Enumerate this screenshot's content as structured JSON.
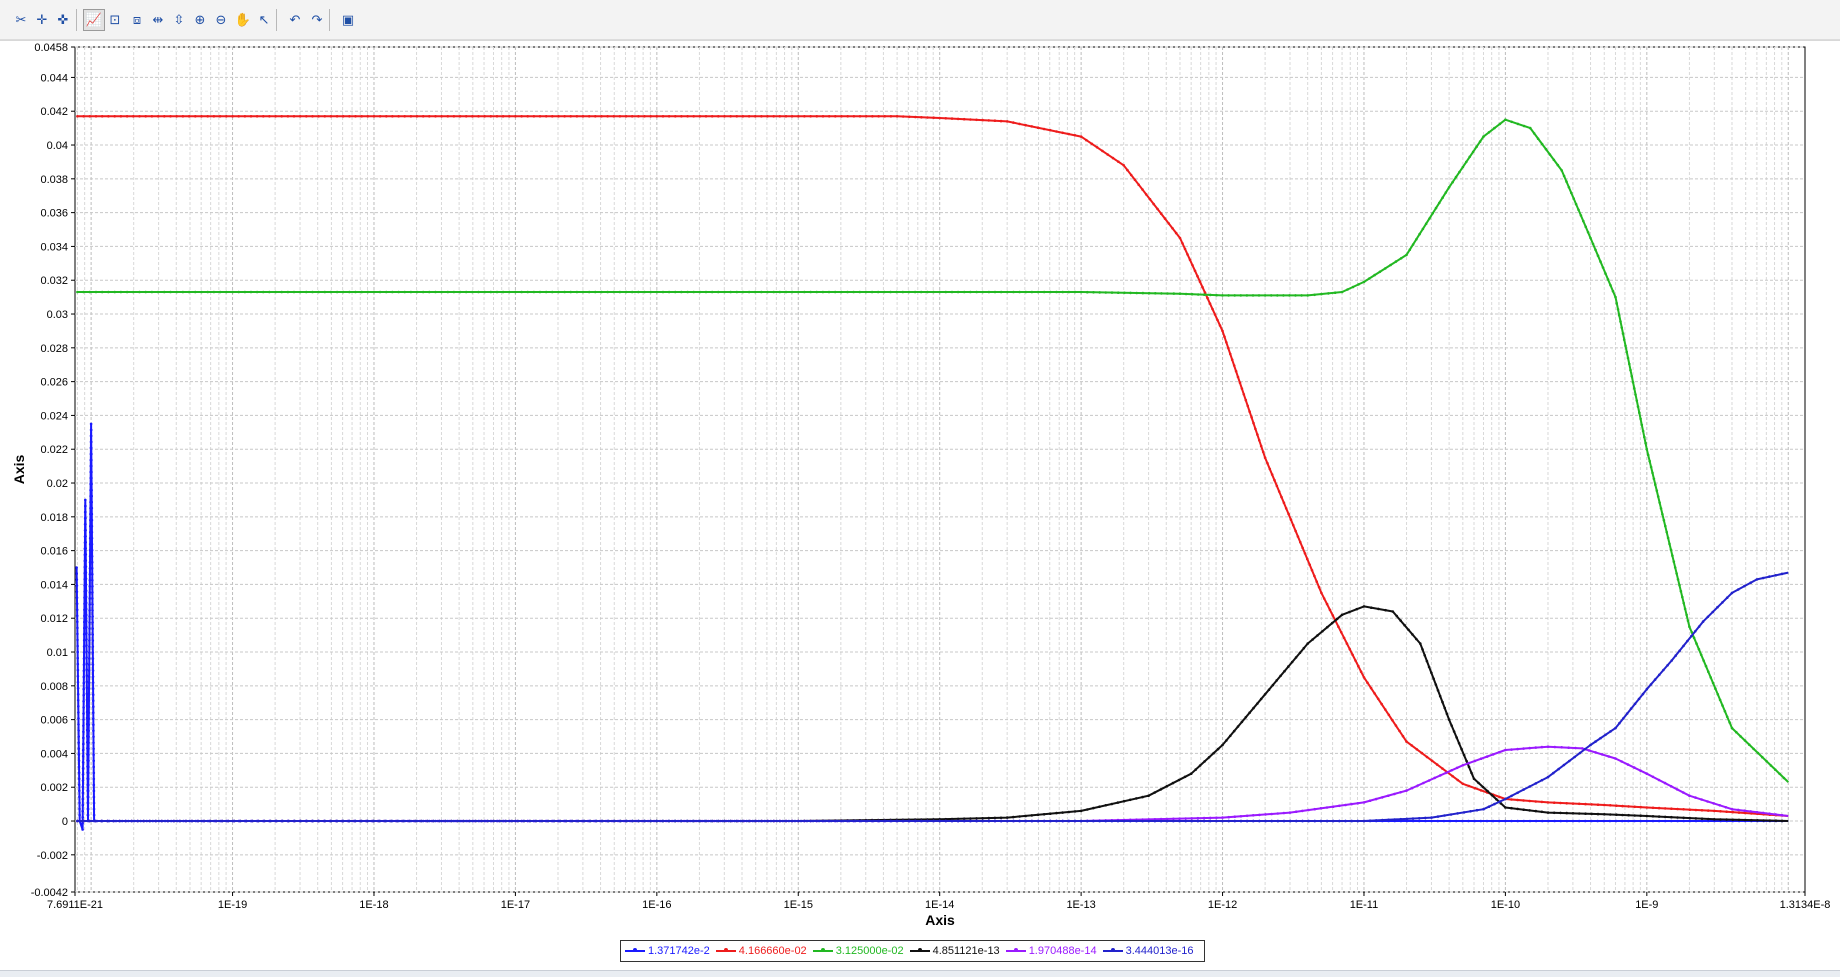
{
  "toolbar": {
    "buttons": [
      {
        "name": "tools-icon",
        "glyph": "✂"
      },
      {
        "name": "add-point-icon",
        "glyph": "✛"
      },
      {
        "name": "remove-point-icon",
        "glyph": "✜"
      },
      {
        "name": "chart-view-icon",
        "glyph": "📈"
      },
      {
        "name": "zoom-box-icon",
        "glyph": "⊡"
      },
      {
        "name": "zoom-fit-icon",
        "glyph": "⧈"
      },
      {
        "name": "zoom-horizontal-icon",
        "glyph": "⇹"
      },
      {
        "name": "zoom-vertical-icon",
        "glyph": "⇳"
      },
      {
        "name": "zoom-in-icon",
        "glyph": "⊕"
      },
      {
        "name": "zoom-out-icon",
        "glyph": "⊖"
      },
      {
        "name": "pan-hand-icon",
        "glyph": "✋"
      },
      {
        "name": "select-pointer-icon",
        "glyph": "↖"
      },
      {
        "name": "undo-icon",
        "glyph": "↶"
      },
      {
        "name": "redo-icon",
        "glyph": "↷"
      },
      {
        "name": "export-image-icon",
        "glyph": "▣"
      }
    ]
  },
  "chart_data": {
    "type": "line",
    "xlabel": "Axis",
    "ylabel": "Axis",
    "xscale": "log",
    "xlim": [
      7.6911e-21,
      1.3134e-08
    ],
    "ylim": [
      -0.0042,
      0.0458
    ],
    "grid": true,
    "legend_position": "bottom",
    "x_tick_labels": [
      "7.6911E-21",
      "1E-19",
      "1E-18",
      "1E-17",
      "1E-16",
      "1E-15",
      "1E-14",
      "1E-13",
      "1E-12",
      "1E-11",
      "1E-10",
      "1E-9",
      "1.3134E-8"
    ],
    "x_tick_values": [
      7.6911e-21,
      1e-19,
      1e-18,
      1e-17,
      1e-16,
      1e-15,
      1e-14,
      1e-13,
      1e-12,
      1e-11,
      1e-10,
      1e-09,
      1.3134e-08
    ],
    "y_tick_labels": [
      "0.0458",
      "0.044",
      "0.042",
      "0.04",
      "0.038",
      "0.036",
      "0.034",
      "0.032",
      "0.03",
      "0.028",
      "0.026",
      "0.024",
      "0.022",
      "0.02",
      "0.018",
      "0.016",
      "0.014",
      "0.012",
      "0.01",
      "0.008",
      "0.006",
      "0.004",
      "0.002",
      "0",
      "-0.002",
      "-0.0042"
    ],
    "y_tick_values": [
      0.0458,
      0.044,
      0.042,
      0.04,
      0.038,
      0.036,
      0.034,
      0.032,
      0.03,
      0.028,
      0.026,
      0.024,
      0.022,
      0.02,
      0.018,
      0.016,
      0.014,
      0.012,
      0.01,
      0.008,
      0.006,
      0.004,
      0.002,
      0,
      -0.002,
      -0.0042
    ],
    "series": [
      {
        "name": "1.371742e-2",
        "color": "#1a1aff",
        "x": [
          7.9e-21,
          8.3e-21,
          8.7e-21,
          9.1e-21,
          9.5e-21,
          1e-20,
          1.05e-20,
          1.1e-20,
          1.2e-20,
          1.5e-20,
          1e-19,
          1e-18,
          1e-17,
          1e-16,
          1e-15,
          1e-14,
          1e-13,
          1e-12,
          1e-11,
          1e-10,
          1e-09,
          1e-08
        ],
        "y": [
          0.015,
          0,
          -0.0005,
          0.019,
          0,
          0.0235,
          0,
          0,
          0,
          0,
          0,
          0,
          0,
          0,
          0,
          0,
          0,
          0,
          0,
          0,
          0,
          0
        ]
      },
      {
        "name": "4.166660e-02",
        "color": "#ee1c1c",
        "x": [
          8e-21,
          1e-19,
          1e-18,
          1e-17,
          1e-16,
          1e-15,
          5e-15,
          1e-14,
          3e-14,
          1e-13,
          2e-13,
          5e-13,
          1e-12,
          2e-12,
          5e-12,
          1e-11,
          2e-11,
          5e-11,
          1e-10,
          2e-10,
          5e-10,
          1e-09,
          3e-09,
          1e-08
        ],
        "y": [
          0.0417,
          0.0417,
          0.0417,
          0.0417,
          0.0417,
          0.0417,
          0.0417,
          0.0416,
          0.0414,
          0.0405,
          0.0388,
          0.0345,
          0.029,
          0.0215,
          0.0135,
          0.0085,
          0.0047,
          0.0022,
          0.0013,
          0.0011,
          0.00095,
          0.0008,
          0.0006,
          0.0003
        ]
      },
      {
        "name": "3.125000e-02",
        "color": "#22b822",
        "x": [
          8e-21,
          1e-19,
          1e-18,
          1e-17,
          1e-16,
          1e-15,
          1e-14,
          1e-13,
          5e-13,
          1e-12,
          2e-12,
          4e-12,
          7e-12,
          1e-11,
          2e-11,
          4e-11,
          7e-11,
          1e-10,
          1.5e-10,
          2.5e-10,
          4e-10,
          6e-10,
          1e-09,
          2e-09,
          4e-09,
          1e-08
        ],
        "y": [
          0.0313,
          0.0313,
          0.0313,
          0.0313,
          0.0313,
          0.0313,
          0.0313,
          0.0313,
          0.0312,
          0.0311,
          0.0311,
          0.0311,
          0.0313,
          0.0319,
          0.0335,
          0.0375,
          0.0405,
          0.0415,
          0.041,
          0.0385,
          0.0345,
          0.031,
          0.022,
          0.0115,
          0.0055,
          0.0023
        ]
      },
      {
        "name": "4.851121e-13",
        "color": "#111111",
        "x": [
          8e-21,
          1e-16,
          1e-15,
          1e-14,
          3e-14,
          1e-13,
          3e-13,
          6e-13,
          1e-12,
          2e-12,
          4e-12,
          7e-12,
          1e-11,
          1.6e-11,
          2.5e-11,
          4e-11,
          6e-11,
          1e-10,
          2e-10,
          5e-10,
          1e-09,
          3e-09,
          1e-08
        ],
        "y": [
          0,
          0,
          0,
          0.0001,
          0.0002,
          0.0006,
          0.0015,
          0.0028,
          0.0045,
          0.0075,
          0.0105,
          0.0122,
          0.0127,
          0.0124,
          0.0105,
          0.006,
          0.0025,
          0.0008,
          0.0005,
          0.0004,
          0.0003,
          0.0001,
          0
        ]
      },
      {
        "name": "1.970488e-14",
        "color": "#9a1aff",
        "x": [
          8e-21,
          1e-15,
          1e-14,
          1e-13,
          1e-12,
          3e-12,
          1e-11,
          2e-11,
          5e-11,
          1e-10,
          2e-10,
          3.5e-10,
          6e-10,
          1e-09,
          2e-09,
          4e-09,
          1e-08
        ],
        "y": [
          0,
          0,
          0,
          0,
          0.0002,
          0.0005,
          0.0011,
          0.0018,
          0.0033,
          0.0042,
          0.0044,
          0.0043,
          0.0037,
          0.0028,
          0.0015,
          0.0007,
          0.0003
        ]
      },
      {
        "name": "3.444013e-16",
        "color": "#2222cc",
        "x": [
          8e-21,
          1e-14,
          1e-13,
          1e-12,
          1e-11,
          3e-11,
          7e-11,
          1e-10,
          2e-10,
          4e-10,
          6e-10,
          1e-09,
          1.5e-09,
          2.5e-09,
          4e-09,
          6e-09,
          1e-08
        ],
        "y": [
          0,
          0,
          0,
          0,
          0,
          0.0002,
          0.0007,
          0.0013,
          0.0026,
          0.0045,
          0.0055,
          0.0078,
          0.0095,
          0.0118,
          0.0135,
          0.0143,
          0.0147
        ]
      }
    ]
  }
}
